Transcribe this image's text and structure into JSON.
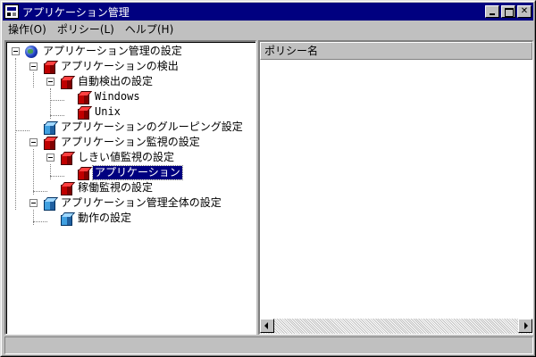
{
  "window": {
    "title": "アプリケーション管理",
    "buttons": {
      "minimize": "",
      "maximize": "",
      "close": "✕"
    }
  },
  "menu": [
    "操作(O)",
    "ポリシー(L)",
    "ヘルプ(H)"
  ],
  "tree": {
    "root": "アプリケーション管理の設定",
    "detection": "アプリケーションの検出",
    "auto_detect": "自動検出の設定",
    "windows": "Windows",
    "unix": "Unix",
    "grouping": "アプリケーションのグルーピング設定",
    "monitoring": "アプリケーション監視の設定",
    "threshold": "しきい値監視の設定",
    "application": "アプリケーション",
    "operation_monitor": "稼働監視の設定",
    "global": "アプリケーション管理全体の設定",
    "behavior": "動作の設定"
  },
  "list": {
    "column_header": "ポリシー名"
  },
  "status": {
    "text": ""
  },
  "colors": {
    "titlebar": "#000080",
    "selection": "#000080",
    "face": "#c0c0c0"
  }
}
